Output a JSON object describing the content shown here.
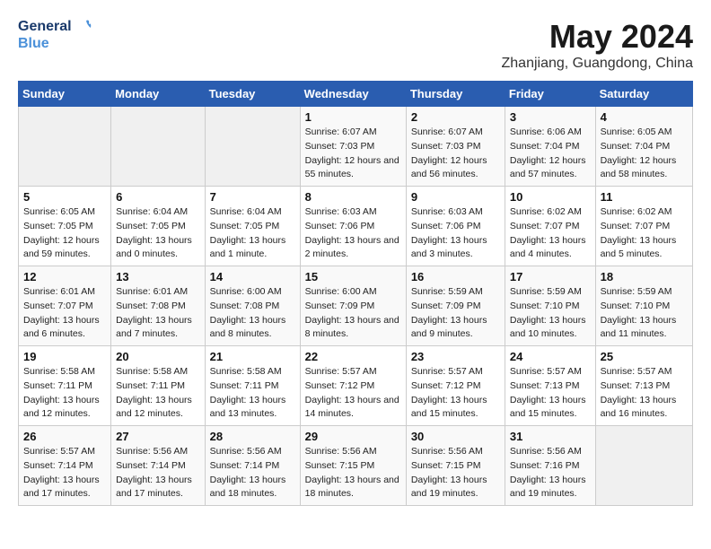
{
  "logo": {
    "line1": "General",
    "line2": "Blue"
  },
  "title": "May 2024",
  "subtitle": "Zhanjiang, Guangdong, China",
  "days_of_week": [
    "Sunday",
    "Monday",
    "Tuesday",
    "Wednesday",
    "Thursday",
    "Friday",
    "Saturday"
  ],
  "weeks": [
    [
      {
        "day": "",
        "empty": true
      },
      {
        "day": "",
        "empty": true
      },
      {
        "day": "",
        "empty": true
      },
      {
        "day": "1",
        "sunrise": "6:07 AM",
        "sunset": "7:03 PM",
        "daylight": "12 hours and 55 minutes."
      },
      {
        "day": "2",
        "sunrise": "6:07 AM",
        "sunset": "7:03 PM",
        "daylight": "12 hours and 56 minutes."
      },
      {
        "day": "3",
        "sunrise": "6:06 AM",
        "sunset": "7:04 PM",
        "daylight": "12 hours and 57 minutes."
      },
      {
        "day": "4",
        "sunrise": "6:05 AM",
        "sunset": "7:04 PM",
        "daylight": "12 hours and 58 minutes."
      }
    ],
    [
      {
        "day": "5",
        "sunrise": "6:05 AM",
        "sunset": "7:05 PM",
        "daylight": "12 hours and 59 minutes."
      },
      {
        "day": "6",
        "sunrise": "6:04 AM",
        "sunset": "7:05 PM",
        "daylight": "13 hours and 0 minutes."
      },
      {
        "day": "7",
        "sunrise": "6:04 AM",
        "sunset": "7:05 PM",
        "daylight": "13 hours and 1 minute."
      },
      {
        "day": "8",
        "sunrise": "6:03 AM",
        "sunset": "7:06 PM",
        "daylight": "13 hours and 2 minutes."
      },
      {
        "day": "9",
        "sunrise": "6:03 AM",
        "sunset": "7:06 PM",
        "daylight": "13 hours and 3 minutes."
      },
      {
        "day": "10",
        "sunrise": "6:02 AM",
        "sunset": "7:07 PM",
        "daylight": "13 hours and 4 minutes."
      },
      {
        "day": "11",
        "sunrise": "6:02 AM",
        "sunset": "7:07 PM",
        "daylight": "13 hours and 5 minutes."
      }
    ],
    [
      {
        "day": "12",
        "sunrise": "6:01 AM",
        "sunset": "7:07 PM",
        "daylight": "13 hours and 6 minutes."
      },
      {
        "day": "13",
        "sunrise": "6:01 AM",
        "sunset": "7:08 PM",
        "daylight": "13 hours and 7 minutes."
      },
      {
        "day": "14",
        "sunrise": "6:00 AM",
        "sunset": "7:08 PM",
        "daylight": "13 hours and 8 minutes."
      },
      {
        "day": "15",
        "sunrise": "6:00 AM",
        "sunset": "7:09 PM",
        "daylight": "13 hours and 8 minutes."
      },
      {
        "day": "16",
        "sunrise": "5:59 AM",
        "sunset": "7:09 PM",
        "daylight": "13 hours and 9 minutes."
      },
      {
        "day": "17",
        "sunrise": "5:59 AM",
        "sunset": "7:10 PM",
        "daylight": "13 hours and 10 minutes."
      },
      {
        "day": "18",
        "sunrise": "5:59 AM",
        "sunset": "7:10 PM",
        "daylight": "13 hours and 11 minutes."
      }
    ],
    [
      {
        "day": "19",
        "sunrise": "5:58 AM",
        "sunset": "7:11 PM",
        "daylight": "13 hours and 12 minutes."
      },
      {
        "day": "20",
        "sunrise": "5:58 AM",
        "sunset": "7:11 PM",
        "daylight": "13 hours and 12 minutes."
      },
      {
        "day": "21",
        "sunrise": "5:58 AM",
        "sunset": "7:11 PM",
        "daylight": "13 hours and 13 minutes."
      },
      {
        "day": "22",
        "sunrise": "5:57 AM",
        "sunset": "7:12 PM",
        "daylight": "13 hours and 14 minutes."
      },
      {
        "day": "23",
        "sunrise": "5:57 AM",
        "sunset": "7:12 PM",
        "daylight": "13 hours and 15 minutes."
      },
      {
        "day": "24",
        "sunrise": "5:57 AM",
        "sunset": "7:13 PM",
        "daylight": "13 hours and 15 minutes."
      },
      {
        "day": "25",
        "sunrise": "5:57 AM",
        "sunset": "7:13 PM",
        "daylight": "13 hours and 16 minutes."
      }
    ],
    [
      {
        "day": "26",
        "sunrise": "5:57 AM",
        "sunset": "7:14 PM",
        "daylight": "13 hours and 17 minutes."
      },
      {
        "day": "27",
        "sunrise": "5:56 AM",
        "sunset": "7:14 PM",
        "daylight": "13 hours and 17 minutes."
      },
      {
        "day": "28",
        "sunrise": "5:56 AM",
        "sunset": "7:14 PM",
        "daylight": "13 hours and 18 minutes."
      },
      {
        "day": "29",
        "sunrise": "5:56 AM",
        "sunset": "7:15 PM",
        "daylight": "13 hours and 18 minutes."
      },
      {
        "day": "30",
        "sunrise": "5:56 AM",
        "sunset": "7:15 PM",
        "daylight": "13 hours and 19 minutes."
      },
      {
        "day": "31",
        "sunrise": "5:56 AM",
        "sunset": "7:16 PM",
        "daylight": "13 hours and 19 minutes."
      },
      {
        "day": "",
        "empty": true
      }
    ]
  ]
}
